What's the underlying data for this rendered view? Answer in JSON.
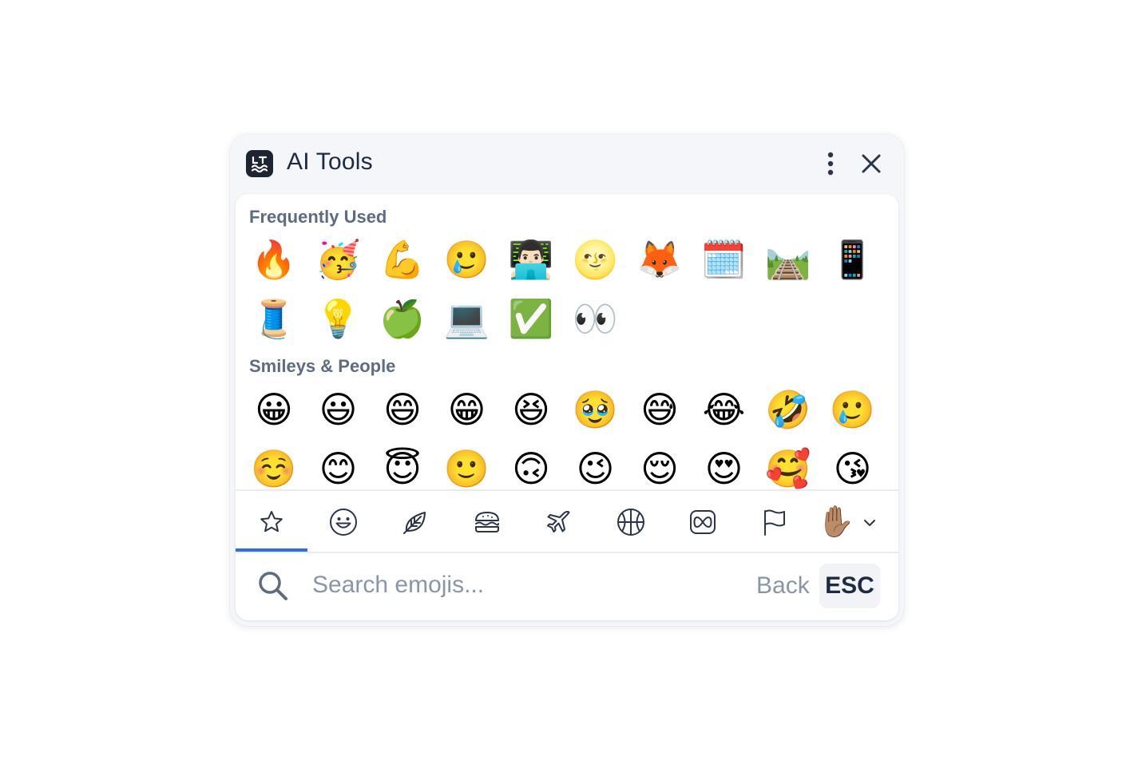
{
  "app": {
    "title": "AI Tools",
    "logo_icon": "languagetool-logo-icon",
    "more_icon": "vertical-dots-icon",
    "close_icon": "close-icon"
  },
  "sections": [
    {
      "title": "Frequently Used",
      "emojis": [
        "🔥",
        "🥳",
        "💪",
        "🥲",
        "👨🏻‍💻",
        "🌝",
        "🦊",
        "🗓️",
        "🛤️",
        "📱",
        "🧵",
        "💡",
        "🍏",
        "💻",
        "✅",
        "👀"
      ]
    },
    {
      "title": "Smileys & People",
      "emojis": [
        "😀",
        "😃",
        "😄",
        "😁",
        "😆",
        "🥹",
        "😅",
        "😂",
        "🤣",
        "🥲",
        "☺️",
        "😊",
        "😇",
        "🙂",
        "🙃",
        "😉",
        "😌",
        "😍",
        "🥰",
        "😘"
      ]
    }
  ],
  "categories": [
    {
      "icon": "star-icon",
      "active": true
    },
    {
      "icon": "smiley-icon",
      "active": false
    },
    {
      "icon": "leaf-icon",
      "active": false
    },
    {
      "icon": "burger-icon",
      "active": false
    },
    {
      "icon": "airplane-icon",
      "active": false
    },
    {
      "icon": "ball-icon",
      "active": false
    },
    {
      "icon": "infinity-symbol-icon",
      "active": false
    },
    {
      "icon": "flag-icon",
      "active": false
    }
  ],
  "skin_tone": {
    "emoji": "✋🏽",
    "chevron_icon": "chevron-down-icon"
  },
  "search": {
    "placeholder": "Search emojis...",
    "value": "",
    "back_label": "Back",
    "esc_label": "ESC",
    "icon": "search-icon"
  },
  "colors": {
    "accent": "#2f6fe6",
    "title_text": "#1d2a3f",
    "section_text": "#5f6b7e",
    "muted_text": "#8a95a6",
    "window_bg": "#f4f6f9",
    "panel_bg": "#ffffff",
    "icon_stroke": "#2b3547"
  }
}
